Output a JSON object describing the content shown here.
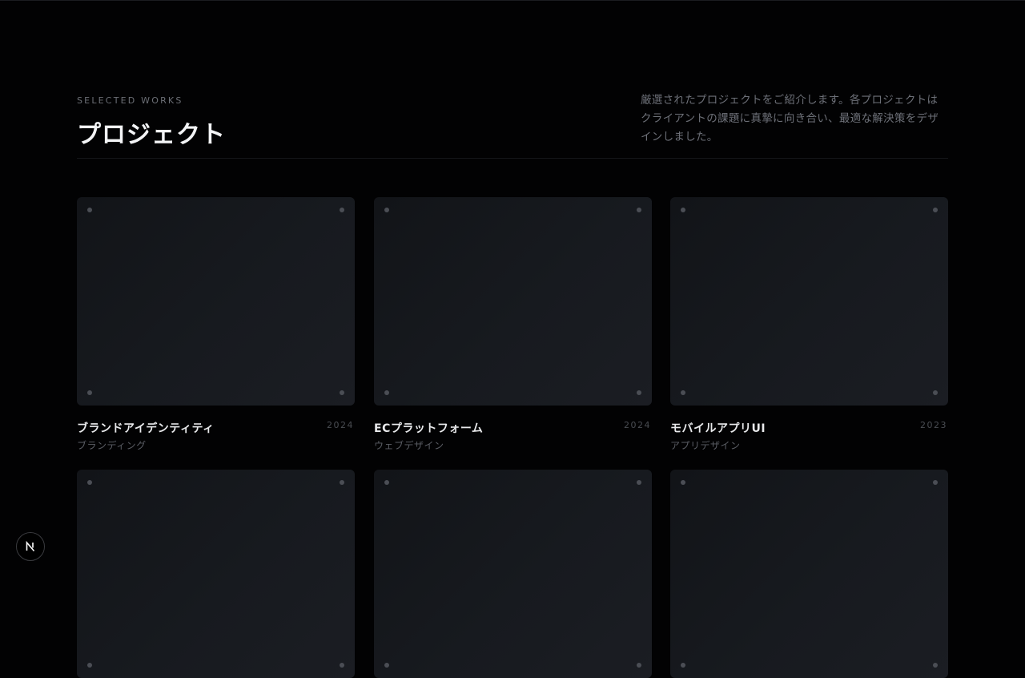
{
  "header": {
    "eyebrow": "SELECTED WORKS",
    "title": "プロジェクト",
    "intro": "厳選されたプロジェクトをご紹介します。各プロジェクトはクライアントの課題に真摯に向き合い、最適な解決策をデザインしました。"
  },
  "projects": [
    {
      "name": "ブランドアイデンティティ",
      "category": "ブランディング",
      "year": "2024"
    },
    {
      "name": "ECプラットフォーム",
      "category": "ウェブデザイン",
      "year": "2024"
    },
    {
      "name": "モバイルアプリUI",
      "category": "アプリデザイン",
      "year": "2023"
    },
    {
      "name": "",
      "category": "",
      "year": ""
    },
    {
      "name": "",
      "category": "",
      "year": ""
    },
    {
      "name": "",
      "category": "",
      "year": ""
    }
  ],
  "dev_badge": {
    "icon": "nextjs-logo-icon"
  }
}
